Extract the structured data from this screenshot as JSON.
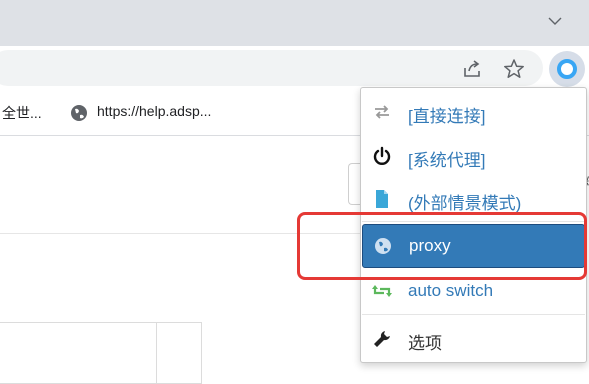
{
  "bookmarks": {
    "item1_label": "全世...",
    "item2_label": "https://help.adsp..."
  },
  "menu": {
    "items": [
      {
        "label": "[直接连接]",
        "icon": "transfer-arrows-icon"
      },
      {
        "label": "[系统代理]",
        "icon": "power-icon"
      },
      {
        "label": "(外部情景模式)",
        "icon": "file-icon"
      },
      {
        "label": "proxy",
        "icon": "globe-icon",
        "state": "selected"
      },
      {
        "label": "auto switch",
        "icon": "retweet-icon"
      },
      {
        "label": "选项",
        "icon": "wrench-icon"
      }
    ]
  },
  "page": {
    "right_fragment": "精"
  },
  "colors": {
    "accent": "#337ab7",
    "highlight": "#e53935",
    "switch_green": "#5cb85c",
    "file_blue": "#3aa7d8"
  }
}
